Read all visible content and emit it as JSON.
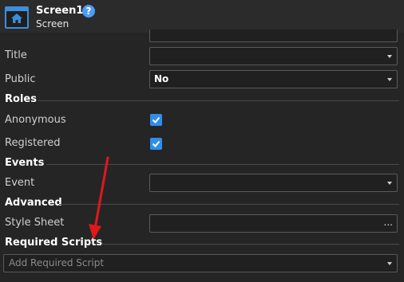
{
  "header": {
    "title": "Screen1",
    "subtitle": "Screen",
    "help": "?"
  },
  "properties": {
    "title_label": "Title",
    "public_label": "Public",
    "public_value": "No",
    "roles_section": "Roles",
    "anonymous_label": "Anonymous",
    "anonymous_checked": true,
    "registered_label": "Registered",
    "registered_checked": true,
    "events_section": "Events",
    "event_label": "Event",
    "advanced_section": "Advanced",
    "stylesheet_label": "Style Sheet",
    "stylesheet_button": "...",
    "required_scripts_section": "Required Scripts",
    "add_script_placeholder": "Add Required Script"
  },
  "colors": {
    "accent": "#2f8eea",
    "annotation_arrow": "#e0181c"
  }
}
